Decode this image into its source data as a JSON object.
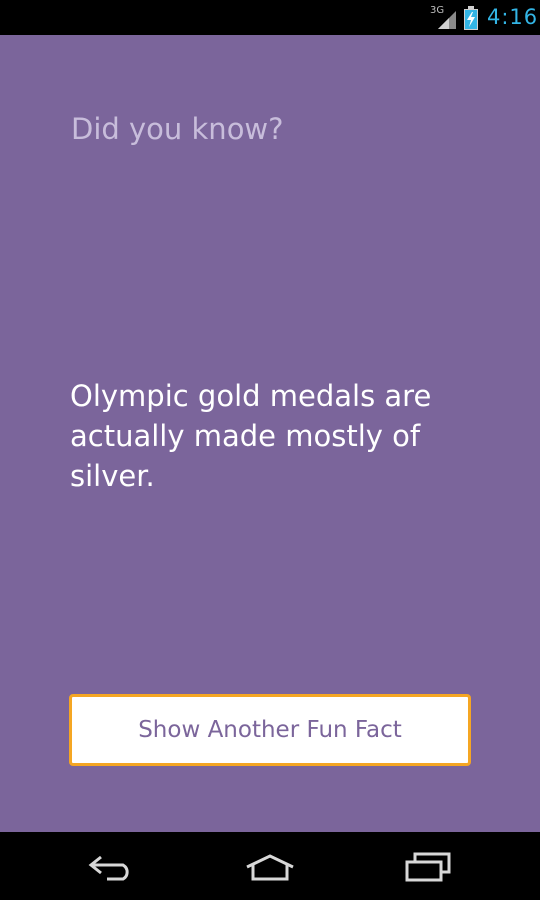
{
  "status_bar": {
    "network": "3G",
    "time": "4:16",
    "icons": [
      "signal-icon",
      "battery-charging-icon"
    ]
  },
  "main": {
    "headline": "Did you know?",
    "fact": "Olympic gold medals are actually made mostly of silver.",
    "button_label": "Show Another Fun Fact"
  },
  "nav_bar": {
    "icons": [
      "back-icon",
      "home-icon",
      "recent-apps-icon"
    ]
  },
  "colors": {
    "background": "#7b659b",
    "headline": "#c8bddb",
    "fact_text": "#ffffff",
    "button_bg": "#ffffff",
    "button_text": "#7b659b",
    "clock": "#33b5e5"
  }
}
